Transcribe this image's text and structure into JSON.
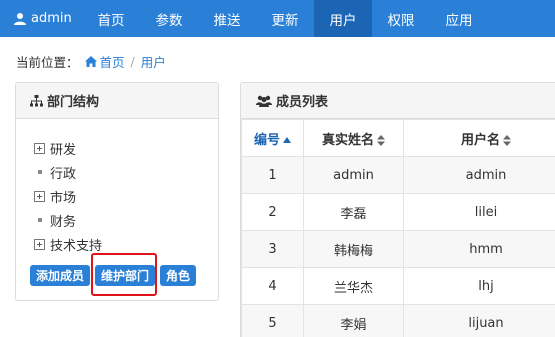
{
  "nav": {
    "brand": "admin",
    "items": [
      {
        "label": "首页"
      },
      {
        "label": "参数"
      },
      {
        "label": "推送"
      },
      {
        "label": "更新"
      },
      {
        "label": "用户"
      },
      {
        "label": "权限"
      },
      {
        "label": "应用"
      }
    ],
    "active_index": 4,
    "bar_color": "#2a7fd6",
    "active_color": "#1c64b4"
  },
  "breadcrumb": {
    "prefix": "当前位置：",
    "home": "首页",
    "separator": "/",
    "current": "用户"
  },
  "dept_panel": {
    "title": "部门结构",
    "tree": [
      {
        "label": "研发",
        "expandable": true
      },
      {
        "label": "行政",
        "expandable": false
      },
      {
        "label": "市场",
        "expandable": true
      },
      {
        "label": "财务",
        "expandable": false
      },
      {
        "label": "技术支持",
        "expandable": true
      }
    ],
    "buttons": {
      "add_member": "添加成员",
      "maintain_dept": "维护部门",
      "role": "角色"
    }
  },
  "member_panel": {
    "title": "成员列表",
    "columns": {
      "id": "编号",
      "real_name": "真实姓名",
      "username": "用户名"
    },
    "rows": [
      {
        "id": "1",
        "real_name": "admin",
        "username": "admin"
      },
      {
        "id": "2",
        "real_name": "李磊",
        "username": "lilei"
      },
      {
        "id": "3",
        "real_name": "韩梅梅",
        "username": "hmm"
      },
      {
        "id": "4",
        "real_name": "兰华杰",
        "username": "lhj"
      },
      {
        "id": "5",
        "real_name": "李娟",
        "username": "lijuan"
      }
    ]
  },
  "colors": {
    "accent": "#2a7fd6",
    "highlight": "#e0131a"
  }
}
